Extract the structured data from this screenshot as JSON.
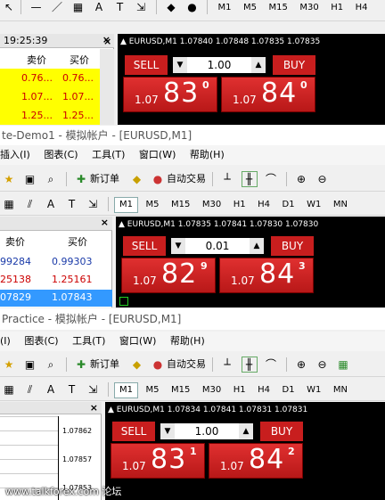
{
  "panel1": {
    "time": "19:25:39",
    "mw_headers": {
      "bid": "卖价",
      "ask": "买价"
    },
    "rows": [
      [
        "0.76...",
        "0.76..."
      ],
      [
        "1.07...",
        "1.07..."
      ],
      [
        "1.25...",
        "1.25..."
      ]
    ],
    "timeframes": [
      "M1",
      "M5",
      "M15",
      "M30",
      "H1",
      "H4"
    ],
    "chart_symbol": "EURUSD,M1  1.07840 1.07848 1.07835 1.07835",
    "sell_label": "SELL",
    "buy_label": "BUY",
    "lots": "1.00",
    "sell_prefix": "1.07",
    "sell_big": "83",
    "sell_sup": "0",
    "buy_prefix": "1.07",
    "buy_big": "84",
    "buy_sup": "0"
  },
  "panel2": {
    "title": "te-Demo1 - 模拟帐户 - [EURUSD,M1]",
    "menu": [
      "插入(I)",
      "图表(C)",
      "工具(T)",
      "窗口(W)",
      "帮助(H)"
    ],
    "new_order": "新订单",
    "auto_trade": "自动交易",
    "timeframes": [
      "M1",
      "M5",
      "M15",
      "M30",
      "H1",
      "H4",
      "D1",
      "W1",
      "MN"
    ],
    "mw_headers": {
      "bid": "卖价",
      "ask": "买价"
    },
    "rows": [
      [
        "99284",
        "0.99303"
      ],
      [
        "25138",
        "1.25161"
      ],
      [
        "07829",
        "1.07843"
      ]
    ],
    "chart_symbol": "EURUSD,M1  1.07835 1.07841 1.07830 1.07830",
    "sell_label": "SELL",
    "buy_label": "BUY",
    "lots": "0.01",
    "sell_prefix": "1.07",
    "sell_big": "82",
    "sell_sup": "9",
    "buy_prefix": "1.07",
    "buy_big": "84",
    "buy_sup": "3"
  },
  "panel3": {
    "title": "Practice - 模拟帐户 - [EURUSD,M1]",
    "menu": [
      "(I)",
      "图表(C)",
      "工具(T)",
      "窗口(W)",
      "帮助(H)"
    ],
    "new_order": "新订单",
    "auto_trade": "自动交易",
    "timeframes": [
      "M1",
      "M5",
      "M15",
      "M30",
      "H1",
      "H4",
      "D1",
      "W1",
      "MN"
    ],
    "price_axis": [
      "1.07862",
      "1.07857",
      "1.07853"
    ],
    "chart_symbol": "EURUSD,M1  1.07834 1.07841 1.07831 1.07831",
    "sell_label": "SELL",
    "buy_label": "BUY",
    "lots": "1.00",
    "sell_prefix": "1.07",
    "sell_big": "83",
    "sell_sup": "1",
    "buy_prefix": "1.07",
    "buy_big": "84",
    "buy_sup": "2"
  },
  "watermark": "www.talkforex.com 论坛",
  "colors": {
    "sell": "#c81e1e",
    "highlight": "#3399ff",
    "yellow_row": "#ffff00"
  }
}
